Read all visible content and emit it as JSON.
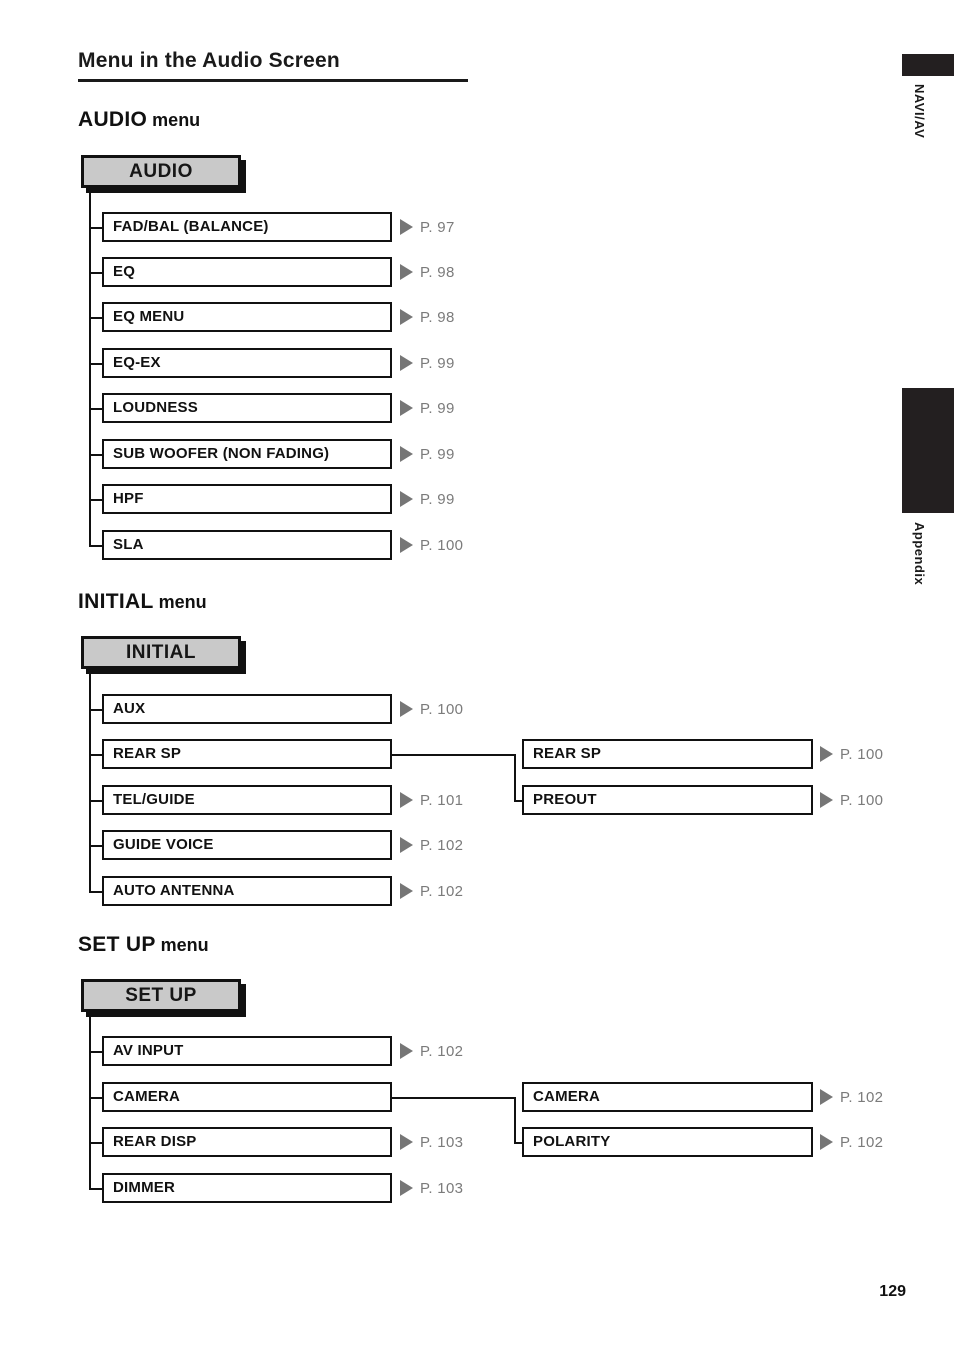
{
  "page": {
    "title": "Menu in the Audio Screen",
    "number": "129"
  },
  "side_tabs": [
    {
      "label": "NAVI/AV",
      "active": false
    },
    {
      "label": "Appendix",
      "active": true
    }
  ],
  "sections": [
    {
      "heading_keyword": "AUDIO",
      "heading_suffix": " menu",
      "root_label": "AUDIO",
      "items": [
        {
          "label": "FAD/BAL (BALANCE)",
          "page_ref": "P. 97"
        },
        {
          "label": "EQ",
          "page_ref": "P. 98"
        },
        {
          "label": "EQ MENU",
          "page_ref": "P. 98"
        },
        {
          "label": "EQ-EX",
          "page_ref": "P. 99"
        },
        {
          "label": "LOUDNESS",
          "page_ref": "P. 99"
        },
        {
          "label": "SUB WOOFER (NON FADING)",
          "page_ref": "P. 99"
        },
        {
          "label": "HPF",
          "page_ref": "P. 99"
        },
        {
          "label": "SLA",
          "page_ref": "P. 100"
        }
      ],
      "sub_items": []
    },
    {
      "heading_keyword": "INITIAL",
      "heading_suffix": " menu",
      "root_label": "INITIAL",
      "items": [
        {
          "label": "AUX",
          "page_ref": "P. 100"
        },
        {
          "label": "REAR SP",
          "page_ref": ""
        },
        {
          "label": "TEL/GUIDE",
          "page_ref": "P. 101"
        },
        {
          "label": "GUIDE VOICE",
          "page_ref": "P. 102"
        },
        {
          "label": "AUTO ANTENNA",
          "page_ref": "P. 102"
        }
      ],
      "sub_items": [
        {
          "label": "REAR SP",
          "page_ref": "P. 100"
        },
        {
          "label": "PREOUT",
          "page_ref": "P. 100"
        }
      ]
    },
    {
      "heading_keyword": "SET UP",
      "heading_suffix": " menu",
      "root_label": "SET UP",
      "items": [
        {
          "label": "AV INPUT",
          "page_ref": "P. 102"
        },
        {
          "label": "CAMERA",
          "page_ref": ""
        },
        {
          "label": "REAR DISP",
          "page_ref": "P. 103"
        },
        {
          "label": "DIMMER",
          "page_ref": "P. 103"
        }
      ],
      "sub_items": [
        {
          "label": "CAMERA",
          "page_ref": "P. 102"
        },
        {
          "label": "POLARITY",
          "page_ref": "P. 102"
        }
      ]
    }
  ],
  "colors": {
    "root_fill": "#c9c9c9",
    "ink": "#111111",
    "pageref_gray": "#7b7b7b",
    "tab_black": "#231f20"
  }
}
